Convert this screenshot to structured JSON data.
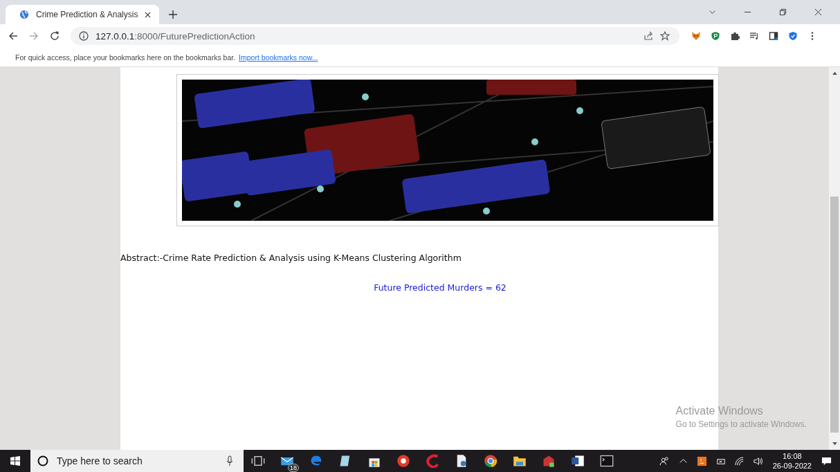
{
  "browser": {
    "tab": {
      "title": "Crime Prediction & Analysis",
      "selected": true
    },
    "address": {
      "host": "127.0.0.1",
      "rest": ":8000/FuturePredictionAction"
    },
    "bookmarks_bar": {
      "text": "For quick access, place your bookmarks here on the bookmarks bar.",
      "link": "Import bookmarks now..."
    }
  },
  "page": {
    "abstract": "Abstract:-Crime Rate Prediction & Analysis using K-Means Clustering Algorithm",
    "result": "Future Predicted Murders = 62"
  },
  "activation_notice": {
    "title": "Activate Windows",
    "subtitle": "Go to Settings to activate Windows."
  },
  "taskbar": {
    "search": {
      "placeholder": "Type here to search"
    },
    "mail_badge": "18",
    "time": "16:08",
    "date": "26-09-2022"
  }
}
